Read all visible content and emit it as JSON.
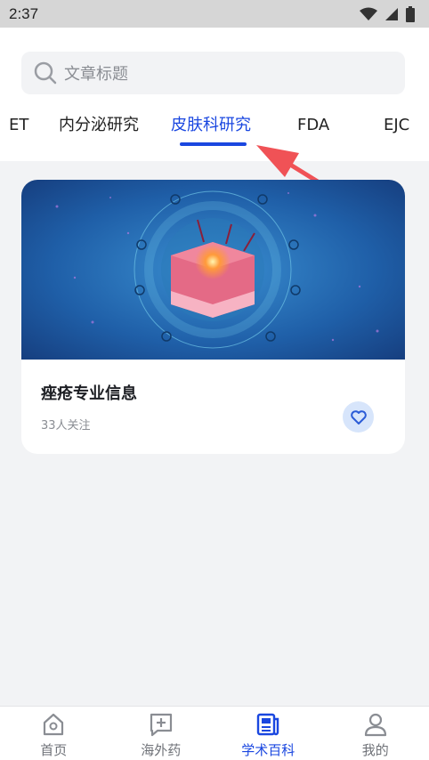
{
  "status": {
    "time": "2:37"
  },
  "search": {
    "placeholder": "文章标题"
  },
  "tabs": [
    {
      "label": "ET"
    },
    {
      "label": "内分泌研究"
    },
    {
      "label": "皮肤科研究"
    },
    {
      "label": "FDA"
    },
    {
      "label": "EJC"
    }
  ],
  "active_tab": "皮肤科研究",
  "article": {
    "title": "痤疮专业信息",
    "followers": "33人关注"
  },
  "nav": {
    "items": [
      {
        "label": "首页",
        "icon": "home-icon"
      },
      {
        "label": "海外药",
        "icon": "medicine-icon"
      },
      {
        "label": "学术百科",
        "icon": "book-icon"
      },
      {
        "label": "我的",
        "icon": "profile-icon"
      }
    ],
    "active": "学术百科"
  },
  "colors": {
    "accent": "#1a47e0",
    "arrow": "#f05256"
  }
}
